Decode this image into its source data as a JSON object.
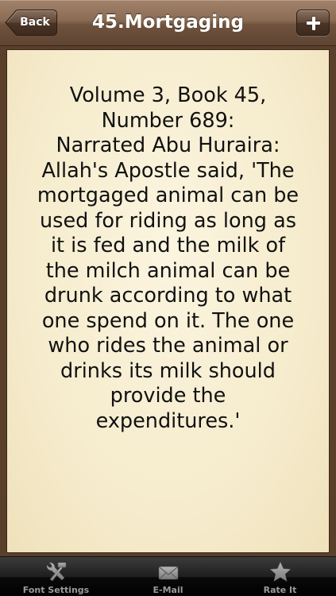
{
  "navbar": {
    "title": "45.Mortgaging",
    "back_label": "Back",
    "add_icon": "plus-icon"
  },
  "content": {
    "text": "Volume 3, Book 45,\nNumber 689:\nNarrated Abu Huraira:\nAllah's Apostle said, 'The\nmortgaged animal can be\nused for riding as long as\nit is fed and the milk of\nthe milch animal can be\ndrunk according to what\none spend on it. The one\nwho rides the animal or\ndrinks its milk should\nprovide the\nexpenditures.'"
  },
  "tabbar": {
    "items": [
      {
        "label": "Font Settings",
        "icon": "tools-icon"
      },
      {
        "label": "E-Mail",
        "icon": "envelope-icon"
      },
      {
        "label": "Rate It",
        "icon": "star-icon"
      }
    ]
  },
  "colors": {
    "navbar": "#8a6b53",
    "paper": "#f6eccd",
    "text": "#111111",
    "tabbar": "#1e1e1e",
    "tab_label": "#9a9a9a"
  }
}
